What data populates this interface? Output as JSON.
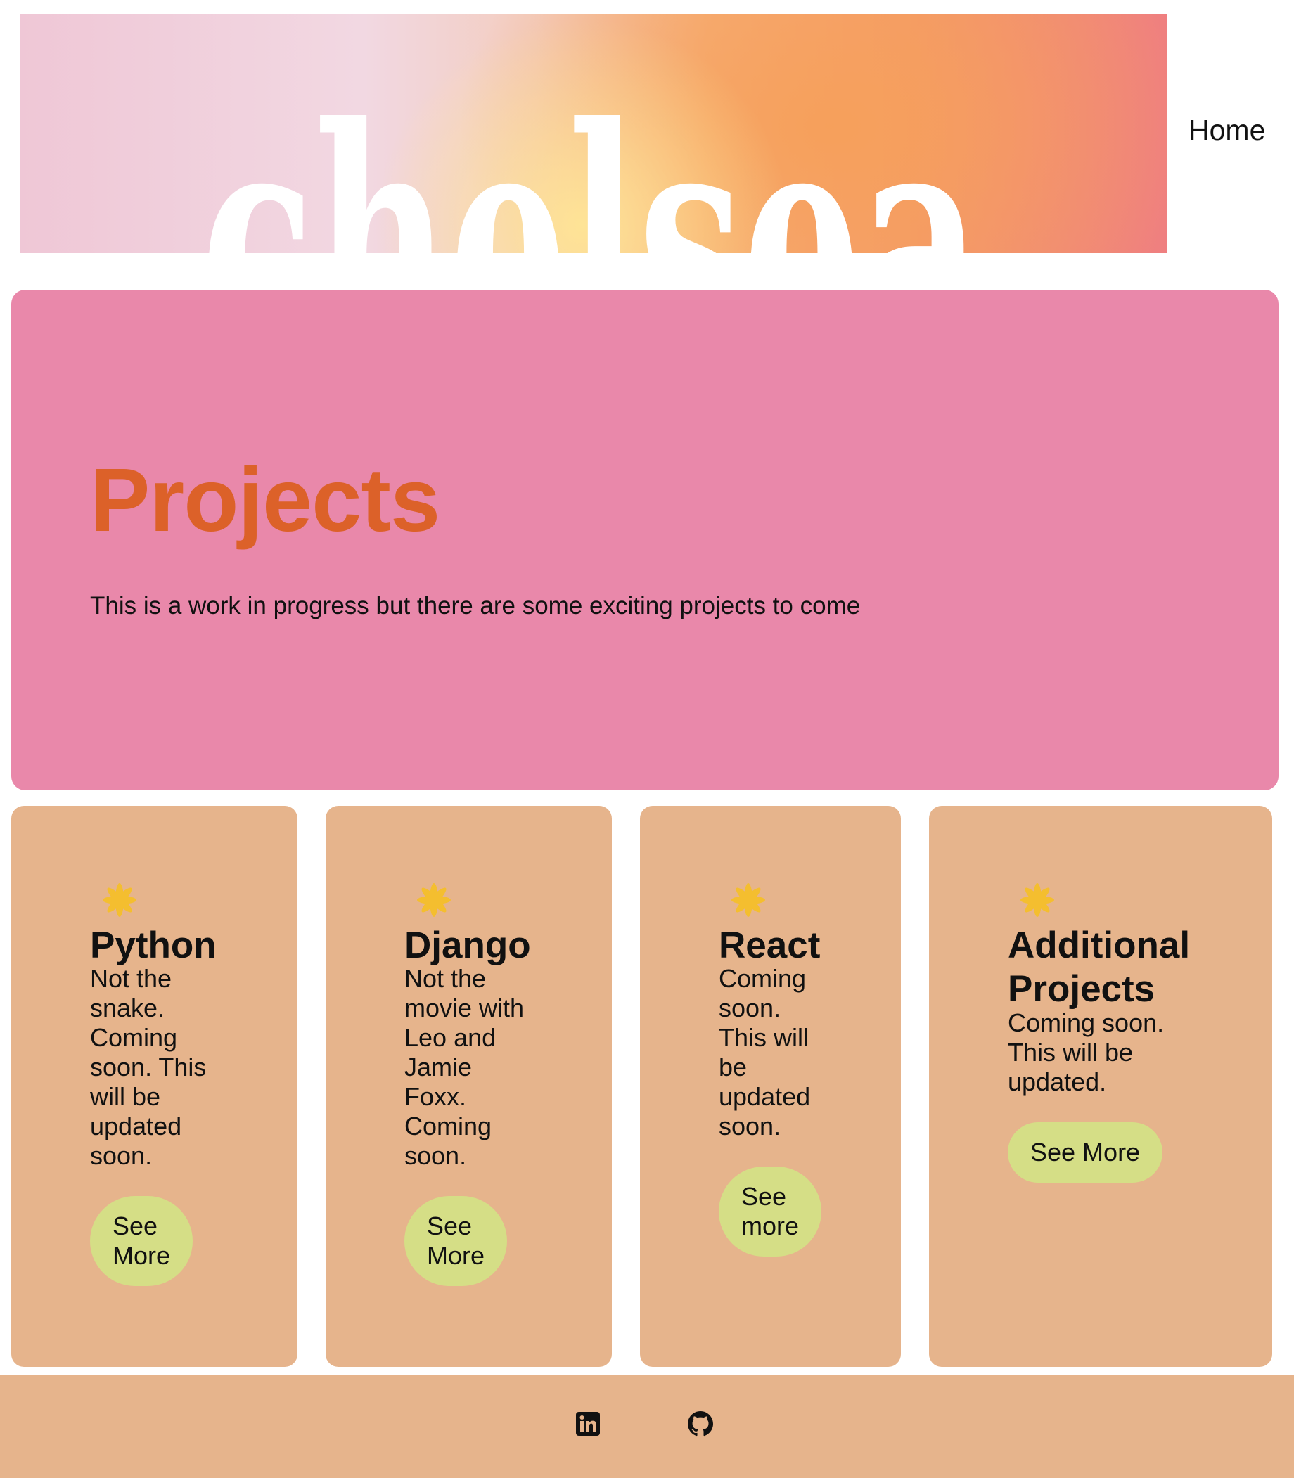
{
  "header": {
    "banner_word": "chelsea",
    "nav_label": "Home"
  },
  "hero": {
    "title": "Projects",
    "subtitle": "This is a work in progress but there are some exciting projects to come"
  },
  "cards": [
    {
      "title": "Python",
      "lines": [
        "Not the",
        "snake.",
        "Coming",
        "soon. This",
        "will be",
        "updated",
        "soon."
      ],
      "button_lines": [
        "See",
        "More"
      ]
    },
    {
      "title": "Django",
      "lines": [
        "Not the",
        "movie with",
        "Leo and",
        "Jamie",
        "Foxx.",
        "Coming",
        "soon."
      ],
      "button_lines": [
        "See",
        "More"
      ]
    },
    {
      "title": "React",
      "lines": [
        "Coming",
        "soon.",
        "This will",
        "be",
        "updated",
        "soon."
      ],
      "button_lines": [
        "See",
        "more"
      ]
    },
    {
      "title_lines": [
        "Additional",
        "Projects"
      ],
      "lines": [
        "Coming soon.",
        "This will be",
        "updated."
      ],
      "button_label": "See More"
    }
  ],
  "footer": {
    "icons": [
      "linkedin-icon",
      "github-icon"
    ]
  },
  "colors": {
    "hero_bg": "#e988aa",
    "title_orange": "#dc6129",
    "card_bg": "#e6b48c",
    "button_bg": "#d5de86",
    "asterisk_yellow": "#f4be2f"
  }
}
